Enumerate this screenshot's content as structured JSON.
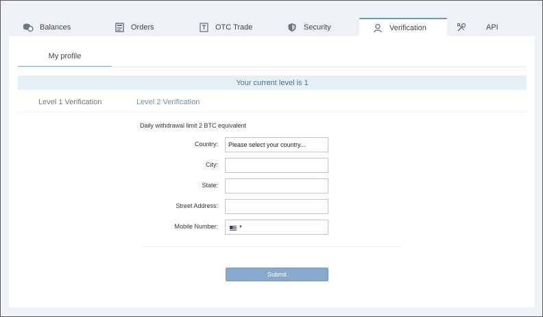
{
  "top_tabs": [
    {
      "label": "Balances",
      "icon": "coins-icon"
    },
    {
      "label": "Orders",
      "icon": "orders-icon"
    },
    {
      "label": "OTC Trade",
      "icon": "otc-trade-icon"
    },
    {
      "label": "Security",
      "icon": "shield-icon"
    },
    {
      "label": "Verification",
      "icon": "user-icon",
      "active": true
    },
    {
      "label": "API",
      "icon": "tools-icon"
    }
  ],
  "subtab": {
    "label": "My profile"
  },
  "level_banner": "Your current level is 1",
  "verification_tabs": {
    "level1": "Level 1 Verification",
    "level2": "Level 2 Verification",
    "active": "level2"
  },
  "form": {
    "limit_text": "Daily withdrawal limit 2 BTC equivalent",
    "country_label": "Country:",
    "country_value": "Please select your country...",
    "city_label": "City:",
    "city_value": "",
    "state_label": "State:",
    "state_value": "",
    "street_label": "Street Address:",
    "street_value": "",
    "mobile_label": "Mobile Number:",
    "mobile_value": "",
    "mobile_flag": "us-flag-icon",
    "submit_label": "Submit"
  },
  "colors": {
    "accent": "#6d95bf",
    "banner_bg": "#e6f0f7",
    "submit_bg": "#88a9cc",
    "page_bg": "#eef1f5"
  }
}
